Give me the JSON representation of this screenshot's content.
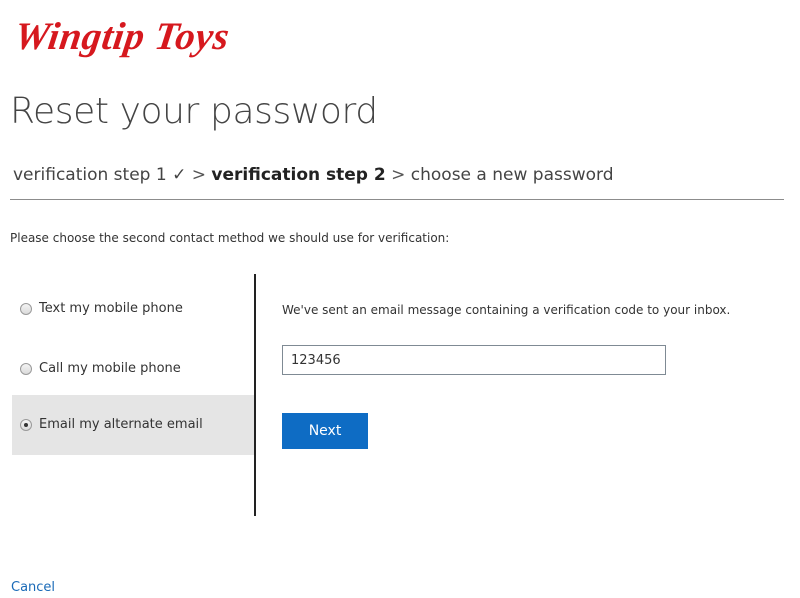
{
  "brand": {
    "logo_text": "Wingtip Toys",
    "color": "#d6181e"
  },
  "page": {
    "title": "Reset your password"
  },
  "breadcrumb": {
    "step1": "verification step 1",
    "step1_check": "✓",
    "separator": ">",
    "step2": "verification step 2",
    "step3": "choose a new password"
  },
  "instruction": "Please choose the second contact method we should use for verification:",
  "methods": [
    {
      "label": "Text my mobile phone",
      "selected": false
    },
    {
      "label": "Call my mobile phone",
      "selected": false
    },
    {
      "label": "Email my alternate email",
      "selected": true
    }
  ],
  "verification": {
    "message": "We've sent an email message containing a verification code to your inbox.",
    "code_value": "123456",
    "next_label": "Next"
  },
  "cancel_label": "Cancel",
  "colors": {
    "accent": "#0e6cc4",
    "link": "#1a6ab7",
    "selected_bg": "#e5e5e5"
  }
}
